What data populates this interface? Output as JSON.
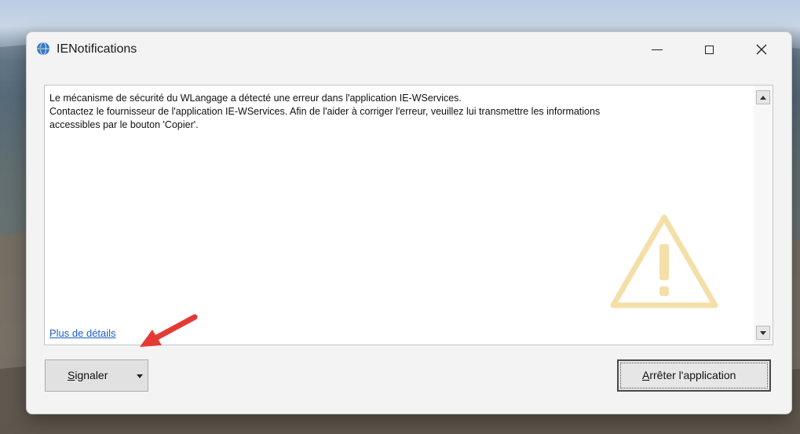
{
  "window": {
    "title": "IENotifications",
    "icon": "globe-icon"
  },
  "controls": {
    "minimize_icon": "minimize-icon",
    "maximize_icon": "maximize-icon",
    "close_icon": "close-icon"
  },
  "message": {
    "line1": "Le mécanisme de sécurité du WLangage a détecté une erreur dans l'application IE-WServices.",
    "line2": "Contactez le fournisseur de l'application IE-WServices. Afin de l'aider à corriger l'erreur, veuillez lui transmettre les informations",
    "line3": "accessibles par le bouton 'Copier'."
  },
  "details_link": "Plus de détails",
  "buttons": {
    "signaler_first": "S",
    "signaler_rest": "ignaler",
    "stop_first": "A",
    "stop_rest": "rrêter l'application"
  },
  "colors": {
    "link": "#1a5fc7",
    "warning_watermark": "#f5dfa8",
    "annotation_arrow": "#e53935"
  }
}
